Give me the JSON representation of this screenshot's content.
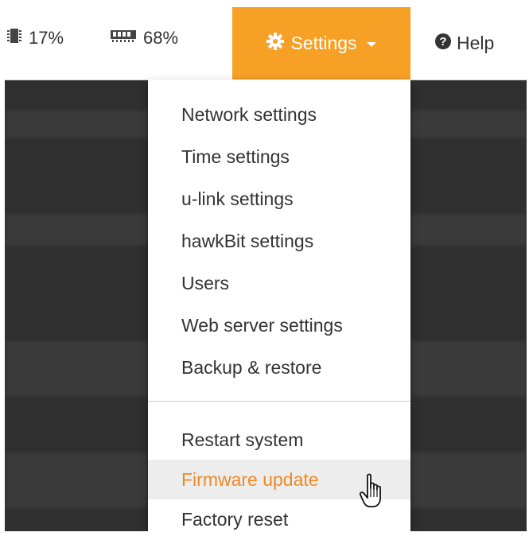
{
  "topbar": {
    "cpu": {
      "icon": "cpu-chip-icon",
      "value": "17%"
    },
    "memory": {
      "icon": "memory-module-icon",
      "value": "68%"
    },
    "settings": {
      "icon": "gear-icon",
      "label": "Settings",
      "caret": "caret-down-icon",
      "bg_color": "#f6a025"
    },
    "help": {
      "icon": "question-circle-icon",
      "label": "Help"
    }
  },
  "menu": {
    "groups": [
      [
        "Network settings",
        "Time settings",
        "u-link settings",
        "hawkBit settings",
        "Users",
        "Web server settings",
        "Backup & restore"
      ],
      [
        "Restart system",
        "Firmware update",
        "Factory reset"
      ]
    ],
    "active_item": "Firmware update",
    "active_color": "#f08a24"
  },
  "cursor": {
    "icon": "hand-pointer-icon"
  }
}
